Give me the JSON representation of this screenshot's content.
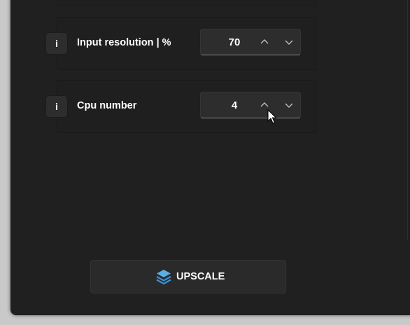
{
  "settings": {
    "rows": [
      {
        "label": "Input resolution | %",
        "value": "70",
        "info_label": "i"
      },
      {
        "label": "Cpu number",
        "value": "4",
        "info_label": "i"
      }
    ]
  },
  "actions": {
    "upscale_label": "UPSCALE",
    "upscale_icon": "layers-icon"
  },
  "icons": {
    "increment": "chevron-up-icon",
    "decrement": "chevron-down-icon"
  },
  "colors": {
    "background": "#202020",
    "control": "#2d2d2d",
    "text": "#ffffff",
    "accent": "#4a9eda"
  }
}
